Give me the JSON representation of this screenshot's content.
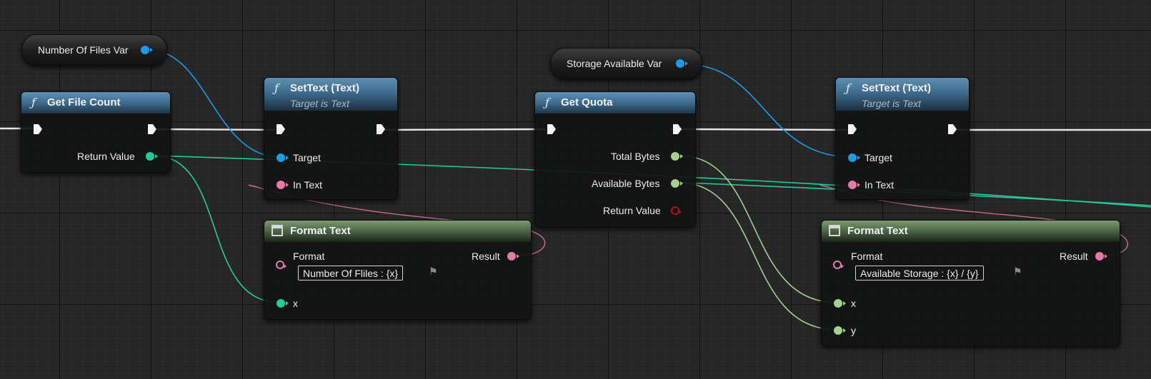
{
  "variables": {
    "number_of_files": "Number Of Files Var",
    "storage_available": "Storage Available Var"
  },
  "get_file_count": {
    "title": "Get File Count",
    "return_value": "Return Value"
  },
  "settext_1": {
    "title": "SetText (Text)",
    "subtitle": "Target is Text",
    "target": "Target",
    "in_text": "In Text"
  },
  "format_text_1": {
    "title": "Format Text",
    "format_label": "Format",
    "format_value": "Number Of Fliles : {x}",
    "result": "Result",
    "x": "x"
  },
  "get_quota": {
    "title": "Get Quota",
    "total_bytes": "Total Bytes",
    "available_bytes": "Available Bytes",
    "return_value": "Return Value"
  },
  "settext_2": {
    "title": "SetText (Text)",
    "subtitle": "Target is Text",
    "target": "Target",
    "in_text": "In Text"
  },
  "format_text_2": {
    "title": "Format Text",
    "format_label": "Format",
    "format_value": "Available Storage : {x} / {y}",
    "result": "Result",
    "x": "x",
    "y": "y"
  },
  "colors": {
    "object_pin": "#1d9be6",
    "integer_pin": "#27c99a",
    "text_pin": "#e679a7",
    "int64_pin": "#a6cf91",
    "exec_wire": "#ffffff",
    "function_header": "#3e6b8d",
    "format_header": "#50684a"
  },
  "icons": {
    "function": "function-icon",
    "format_text": "format-text-icon",
    "exec": "exec-pin-icon",
    "flag": "flag-icon"
  }
}
